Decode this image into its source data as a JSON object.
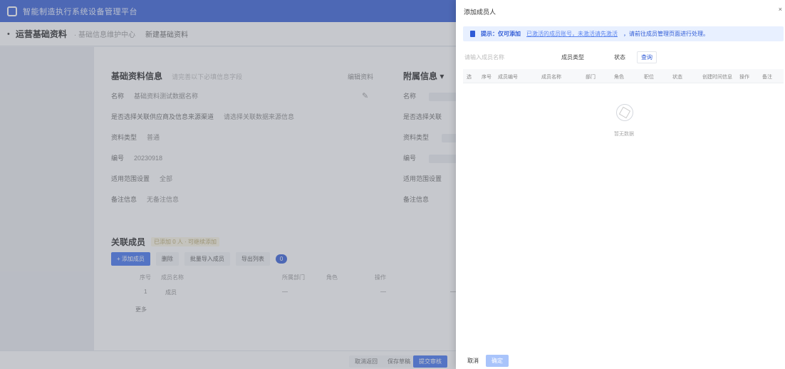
{
  "app": {
    "system_title": "智能制造执行系统设备管理平台"
  },
  "subheader": {
    "back_icon": "•",
    "page_title": "运营基础资料",
    "crumb": "· 基础信息维护中心",
    "crumb_current": "新建基础资料"
  },
  "basic_info": {
    "title": "基础资料信息",
    "note": "请完善以下必填信息字段",
    "edit_label": "编辑资料",
    "edit_icon": "pencil-icon",
    "rows": [
      {
        "key": "名称",
        "value": "基础资料测试数据名称"
      },
      {
        "key": "是否选择关联供应商及信息来源渠道",
        "value": "请选择关联数据来源信息"
      },
      {
        "key": "资料类型",
        "value": "普通"
      },
      {
        "key": "编号",
        "value": "20230918"
      },
      {
        "key": "适用范围设置",
        "value": "全部"
      },
      {
        "key": "备注信息",
        "value": "无备注信息"
      }
    ]
  },
  "side_info": {
    "title": "附属信息 ▾",
    "rows": [
      "名称",
      "是否选择关联",
      "资料类型",
      "编号",
      "适用范围设置",
      "备注信息"
    ]
  },
  "members": {
    "title": "关联成员",
    "badge": "已添加 0 人 · 可继续添加",
    "buttons": [
      "+ 添加成员",
      "删除",
      "批量导入成员",
      "导出列表",
      "0"
    ],
    "columns": [
      "序号",
      "成员名称",
      "所属部门",
      "角色",
      "操作"
    ],
    "row": [
      "1",
      "成员",
      "—",
      "—",
      "—"
    ],
    "more": "更多"
  },
  "footer": {
    "buttons": [
      "取消返回",
      "保存草稿",
      "提交审核"
    ]
  },
  "drawer": {
    "title": "添加成员人",
    "close_icon": "close-icon",
    "close_glyph": "×",
    "notice": {
      "icon": "info-icon",
      "lead": "提示：仅可添加",
      "link": "已激活的成员账号，未激活请先激活",
      "tail": "，请前往成员管理页面进行处理。"
    },
    "search": {
      "placeholder": "请输入成员名称",
      "label_1": "成员类型",
      "label_2": "状态",
      "reset": "查询"
    },
    "columns": [
      "选",
      "序号",
      "成员编号",
      "成员名称",
      "部门",
      "角色",
      "职位",
      "状态",
      "创建时间信息",
      "操作",
      "备注"
    ],
    "empty_icon": "empty-box-icon",
    "empty_text": "暂无数据",
    "cancel": "取消",
    "confirm": "确定"
  }
}
